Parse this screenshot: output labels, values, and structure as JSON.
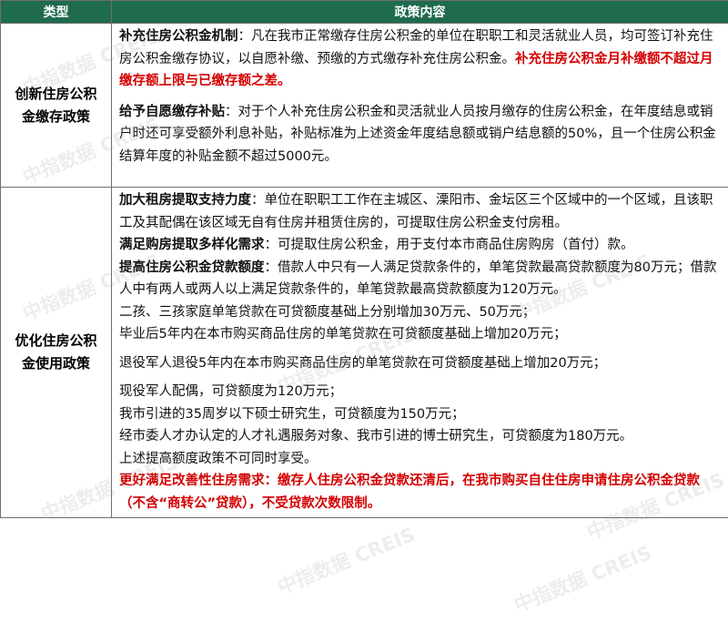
{
  "header": {
    "type": "类型",
    "content": "政策内容"
  },
  "rows": [
    {
      "type_l1": "创新住房公积",
      "type_l2": "金缴存政策",
      "paras": [
        {
          "h": "补充住房公积金机制",
          "t": "：凡在我市正常缴存住房公积金的单位在职职工和灵活就业人员，均可签订补充住房公积金缴存协议，以自愿补缴、预缴的方式缴存补充住房公积金。",
          "r": "补充住房公积金月补缴额不超过月缴存额上限与已缴存额之差。"
        },
        {
          "h": "给予自愿缴存补贴",
          "t": "：对于个人补充住房公积金和灵活就业人员按月缴存的住房公积金，在年度结息或销户时还可享受额外利息补贴，补贴标准为上述资金年度结息额或销户结息额的50%，且一个住房公积金结算年度的补贴金额不超过5000元。"
        }
      ]
    },
    {
      "type_l1": "优化住房公积",
      "type_l2": "金使用政策",
      "paras": [
        {
          "h": "加大租房提取支持力度",
          "t": "：单位在职职工工作在主城区、溧阳市、金坛区三个区域中的一个区域，且该职工及其配偶在该区域无自有住房并租赁住房的，可提取住房公积金支付房租。"
        },
        {
          "h": "满足购房提取多样化需求",
          "t": "：可提取住房公积金，用于支付本市商品住房购房（首付）款。"
        },
        {
          "h": "提高住房公积金贷款额度",
          "t": "：借款人中只有一人满足贷款条件的，单笔贷款最高贷款额度为80万元；借款人中有两人或两人以上满足贷款条件的，单笔贷款最高贷款额度为120万元。"
        },
        {
          "t": "二孩、三孩家庭单笔贷款在可贷额度基础上分别增加30万元、50万元；"
        },
        {
          "t": "毕业后5年内在本市购买商品住房的单笔贷款在可贷额度基础上增加20万元；"
        },
        {
          "gap": true
        },
        {
          "t": "退役军人退役5年内在本市购买商品住房的单笔贷款在可贷额度基础上增加20万元；"
        },
        {
          "gap": true
        },
        {
          "t": "现役军人配偶，可贷额度为120万元；"
        },
        {
          "t": "我市引进的35周岁以下硕士研究生，可贷额度为150万元；"
        },
        {
          "t": " 经市委人才办认定的人才礼遇服务对象、我市引进的博士研究生，可贷额度为180万元。"
        },
        {
          "t": "上述提高额度政策不可同时享受。"
        },
        {
          "r": "更好满足改善性住房需求：缴存人住房公积金贷款还清后，在我市购买自住住房申请住房公积金贷款（不含“商转公”贷款），不受贷款次数限制。"
        }
      ]
    }
  ],
  "watermark": "中指数据 CREIS",
  "colors": {
    "header_bg": "#1e6b4e",
    "emphasis": "#d40000",
    "border": "#6e6e6e"
  }
}
